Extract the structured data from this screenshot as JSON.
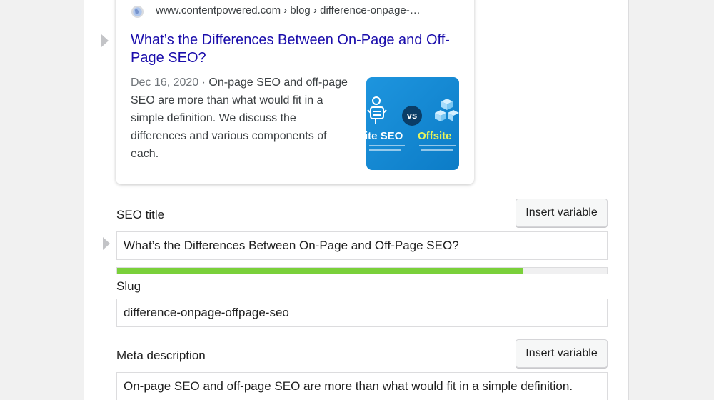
{
  "snippet": {
    "breadcrumb": "www.contentpowered.com › blog › difference-onpage-…",
    "title": "What’s the Differences Between On-Page and Off-Page SEO?",
    "date": "Dec 16, 2020",
    "date_separator": " · ",
    "description": "On-page SEO and off-page SEO are more than what would fit in a simple definition. We discuss the differences and various components of each.",
    "thumbnail": {
      "vs_label": "vs",
      "left_label": "ite SEO",
      "right_label": "Offsite"
    }
  },
  "seo_title": {
    "label": "SEO title",
    "insert_button": "Insert variable",
    "value": "What’s the Differences Between On-Page and Off-Page SEO?",
    "progress_fraction": 0.83,
    "progress_color": "#7ad03a"
  },
  "slug": {
    "label": "Slug",
    "value": "difference-onpage-offpage-seo"
  },
  "meta_description": {
    "label": "Meta description",
    "insert_button": "Insert variable",
    "value": "On-page SEO and off-page SEO are more than what would fit in a simple definition."
  },
  "colors": {
    "link": "#1a0dab",
    "accent_green": "#7ad03a",
    "thumb_blue": "#1e95de"
  }
}
